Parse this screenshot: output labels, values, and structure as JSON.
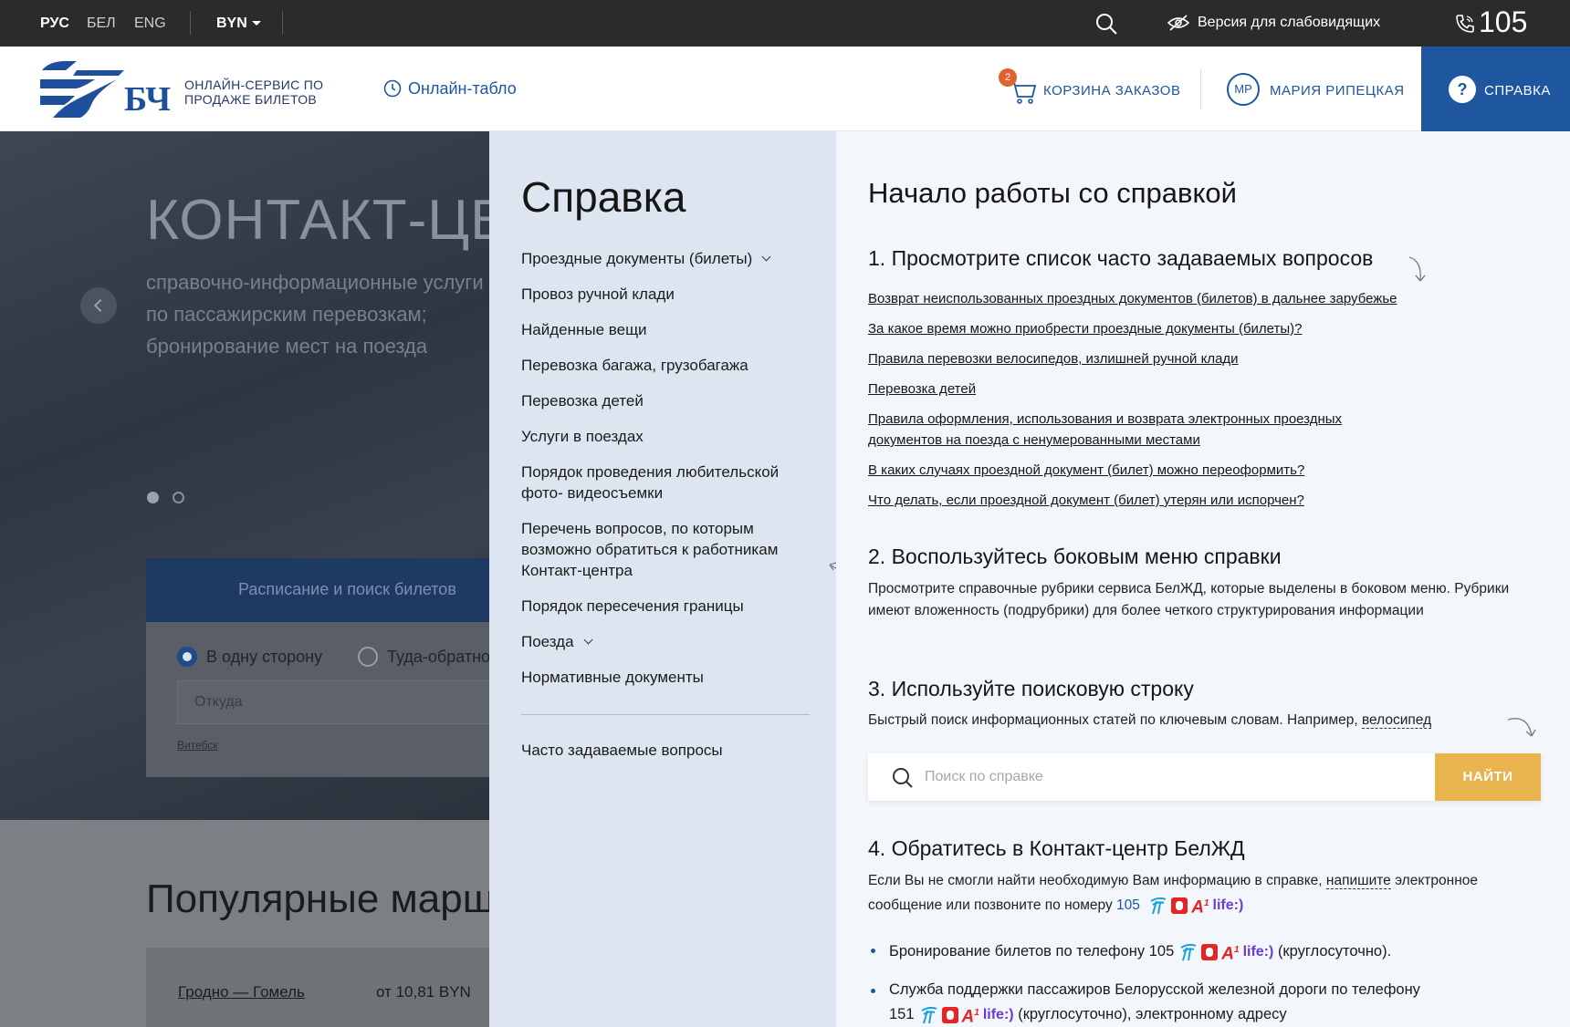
{
  "topbar": {
    "languages": [
      "РУС",
      "БЕЛ",
      "ENG"
    ],
    "currency": "BYN",
    "low_vision": "Версия для слабовидящих",
    "phone": "105"
  },
  "header": {
    "logo_text": "БЧ",
    "service_line1": "ОНЛАЙН-СЕРВИС ПО",
    "service_line2": "ПРОДАЖЕ БИЛЕТОВ",
    "online_board": "Онлайн-табло",
    "cart_count": "2",
    "cart_label": "КОРЗИНА ЗАКАЗОВ",
    "user_initials": "МР",
    "user_name": "МАРИЯ РИПЕЦКАЯ",
    "help_label": "СПРАВКА"
  },
  "background_page": {
    "hero_title": "КОНТАКТ-ЦЕНТР",
    "hero_line1": "справочно-информационные услуги",
    "hero_line2": "по пассажирским перевозкам;",
    "hero_line3": "бронирование мест на поезда",
    "search_tab": "Расписание и поиск билетов",
    "radio_one_way": "В одну сторону",
    "radio_round": "Туда-обратно",
    "from_placeholder": "Откуда",
    "from_hint": "Витебск",
    "popular_title": "Популярные маршруты",
    "route_name": "Гродно — Гомель",
    "route_price": "от 10,81 BYN"
  },
  "sidebar": {
    "title": "Справка",
    "items": [
      {
        "label": "Проездные документы (билеты)",
        "expandable": true
      },
      {
        "label": "Провоз ручной клади",
        "expandable": false
      },
      {
        "label": "Найденные вещи",
        "expandable": false
      },
      {
        "label": "Перевозка багажа, грузобагажа",
        "expandable": false
      },
      {
        "label": "Перевозка детей",
        "expandable": false
      },
      {
        "label": "Услуги в поездах",
        "expandable": false
      },
      {
        "label": "Порядок проведения любительской фото- видеосъемки",
        "expandable": false
      },
      {
        "label": "Перечень вопросов, по которым возможно обратиться к работникам Контакт-центра",
        "expandable": false
      },
      {
        "label": "Порядок пересечения границы",
        "expandable": false
      },
      {
        "label": "Поезда",
        "expandable": true
      },
      {
        "label": "Нормативные документы",
        "expandable": false
      }
    ],
    "faq": "Часто задаваемые вопросы"
  },
  "main": {
    "title": "Начало работы со справкой",
    "step1_title": "1. Просмотрите список часто задаваемых вопросов",
    "faq_links": [
      "Возврат неиспользованных проездных документов (билетов) в дальнее зарубежье",
      "За какое время можно приобрести проездные документы (билеты)?",
      "Правила перевозки велосипедов, излишней ручной клади",
      "Перевозка детей",
      "Правила оформления, использования и возврата электронных проездных документов на поезда с ненумерованными местами",
      "В каких случаях проездной документ (билет) можно переоформить?",
      "Что делать, если проездной документ (билет) утерян или испорчен?"
    ],
    "step2_title": "2. Воспользуйтесь боковым меню справки",
    "step2_text": "Просмотрите справочные рубрики сервиса БелЖД, которые выделены в боковом меню. Рубрики имеют вложенность (подрубрики) для более четкого структурирования информации",
    "step3_title": "3. Используйте поисковую строку",
    "step3_text": "Быстрый поиск информационных статей по ключевым словам. Например,",
    "step3_example": "велосипед",
    "search_placeholder": "Поиск по справке",
    "search_button": "НАЙТИ",
    "step4_title": "4. Обратитесь в Контакт-центр БелЖД",
    "step4_text_a": "Если Вы не смогли найти необходимую Вам информацию в справке,",
    "step4_write": "напишите",
    "step4_text_b": "электронное сообщение или позвоните по номеру",
    "step4_phone": "105",
    "bullet1_a": "Бронирование билетов по телефону 105",
    "bullet1_b": "(круглосуточно).",
    "bullet2_a": "Служба поддержки пассажиров Белорусской железной дороги по телефону 151",
    "bullet2_b": "(круглосуточно), электронному адресу",
    "op_a1": "A",
    "op_a1_sup": "1",
    "op_life": "life:)"
  }
}
